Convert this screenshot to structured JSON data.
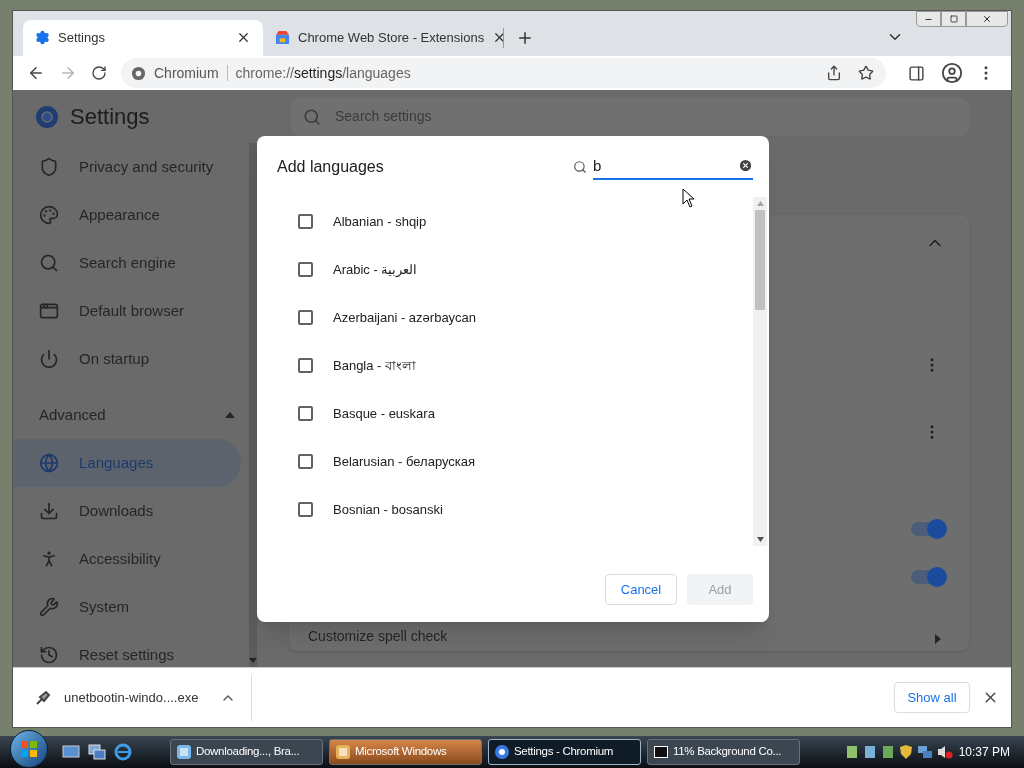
{
  "tabs": [
    {
      "label": "Settings",
      "selected": true
    },
    {
      "label": "Chrome Web Store - Extensions",
      "selected": false
    }
  ],
  "omnibox": {
    "site_label": "Chromium",
    "url_scheme": "chrome://",
    "url_host": "settings",
    "url_path": "/languages"
  },
  "settings": {
    "title": "Settings",
    "search_placeholder": "Search settings",
    "sidebar_items": [
      {
        "label": "Privacy and security",
        "selected": false
      },
      {
        "label": "Appearance",
        "selected": false
      },
      {
        "label": "Search engine",
        "selected": false
      },
      {
        "label": "Default browser",
        "selected": false
      },
      {
        "label": "On startup",
        "selected": false
      }
    ],
    "advanced": {
      "label": "Advanced",
      "expanded": true
    },
    "advanced_items": [
      {
        "label": "Languages",
        "selected": true
      },
      {
        "label": "Downloads",
        "selected": false
      },
      {
        "label": "Accessibility",
        "selected": false
      },
      {
        "label": "System",
        "selected": false
      },
      {
        "label": "Reset settings",
        "selected": false
      }
    ],
    "card": {
      "expanded": true,
      "toggles": [
        {
          "on": true
        },
        {
          "on": true
        }
      ],
      "spell_check_label": "Customize spell check"
    }
  },
  "dialog": {
    "title": "Add languages",
    "search_value": "b",
    "languages": [
      {
        "label": "Albanian - shqip",
        "checked": false
      },
      {
        "label": "Arabic - العربية",
        "checked": false
      },
      {
        "label": "Azerbaijani - azərbaycan",
        "checked": false
      },
      {
        "label": "Bangla - বাংলা",
        "checked": false
      },
      {
        "label": "Basque - euskara",
        "checked": false
      },
      {
        "label": "Belarusian - беларуская",
        "checked": false
      },
      {
        "label": "Bosnian - bosanski",
        "checked": false
      }
    ],
    "cancel": {
      "label": "Cancel"
    },
    "add": {
      "label": "Add",
      "disabled": true
    }
  },
  "download_bar": {
    "file": "unetbootin-windo....exe",
    "show_all": "Show all"
  },
  "taskbar": {
    "items": [
      {
        "label": "Downloading..., Bra...",
        "selected": false,
        "flashing": false
      },
      {
        "label": "Microsoft Windows",
        "selected": false,
        "flashing": true
      },
      {
        "label": "Settings - Chromium",
        "selected": true,
        "flashing": false
      },
      {
        "label": "11% Background Co...",
        "selected": false,
        "flashing": false
      }
    ],
    "clock": "10:37 PM"
  }
}
